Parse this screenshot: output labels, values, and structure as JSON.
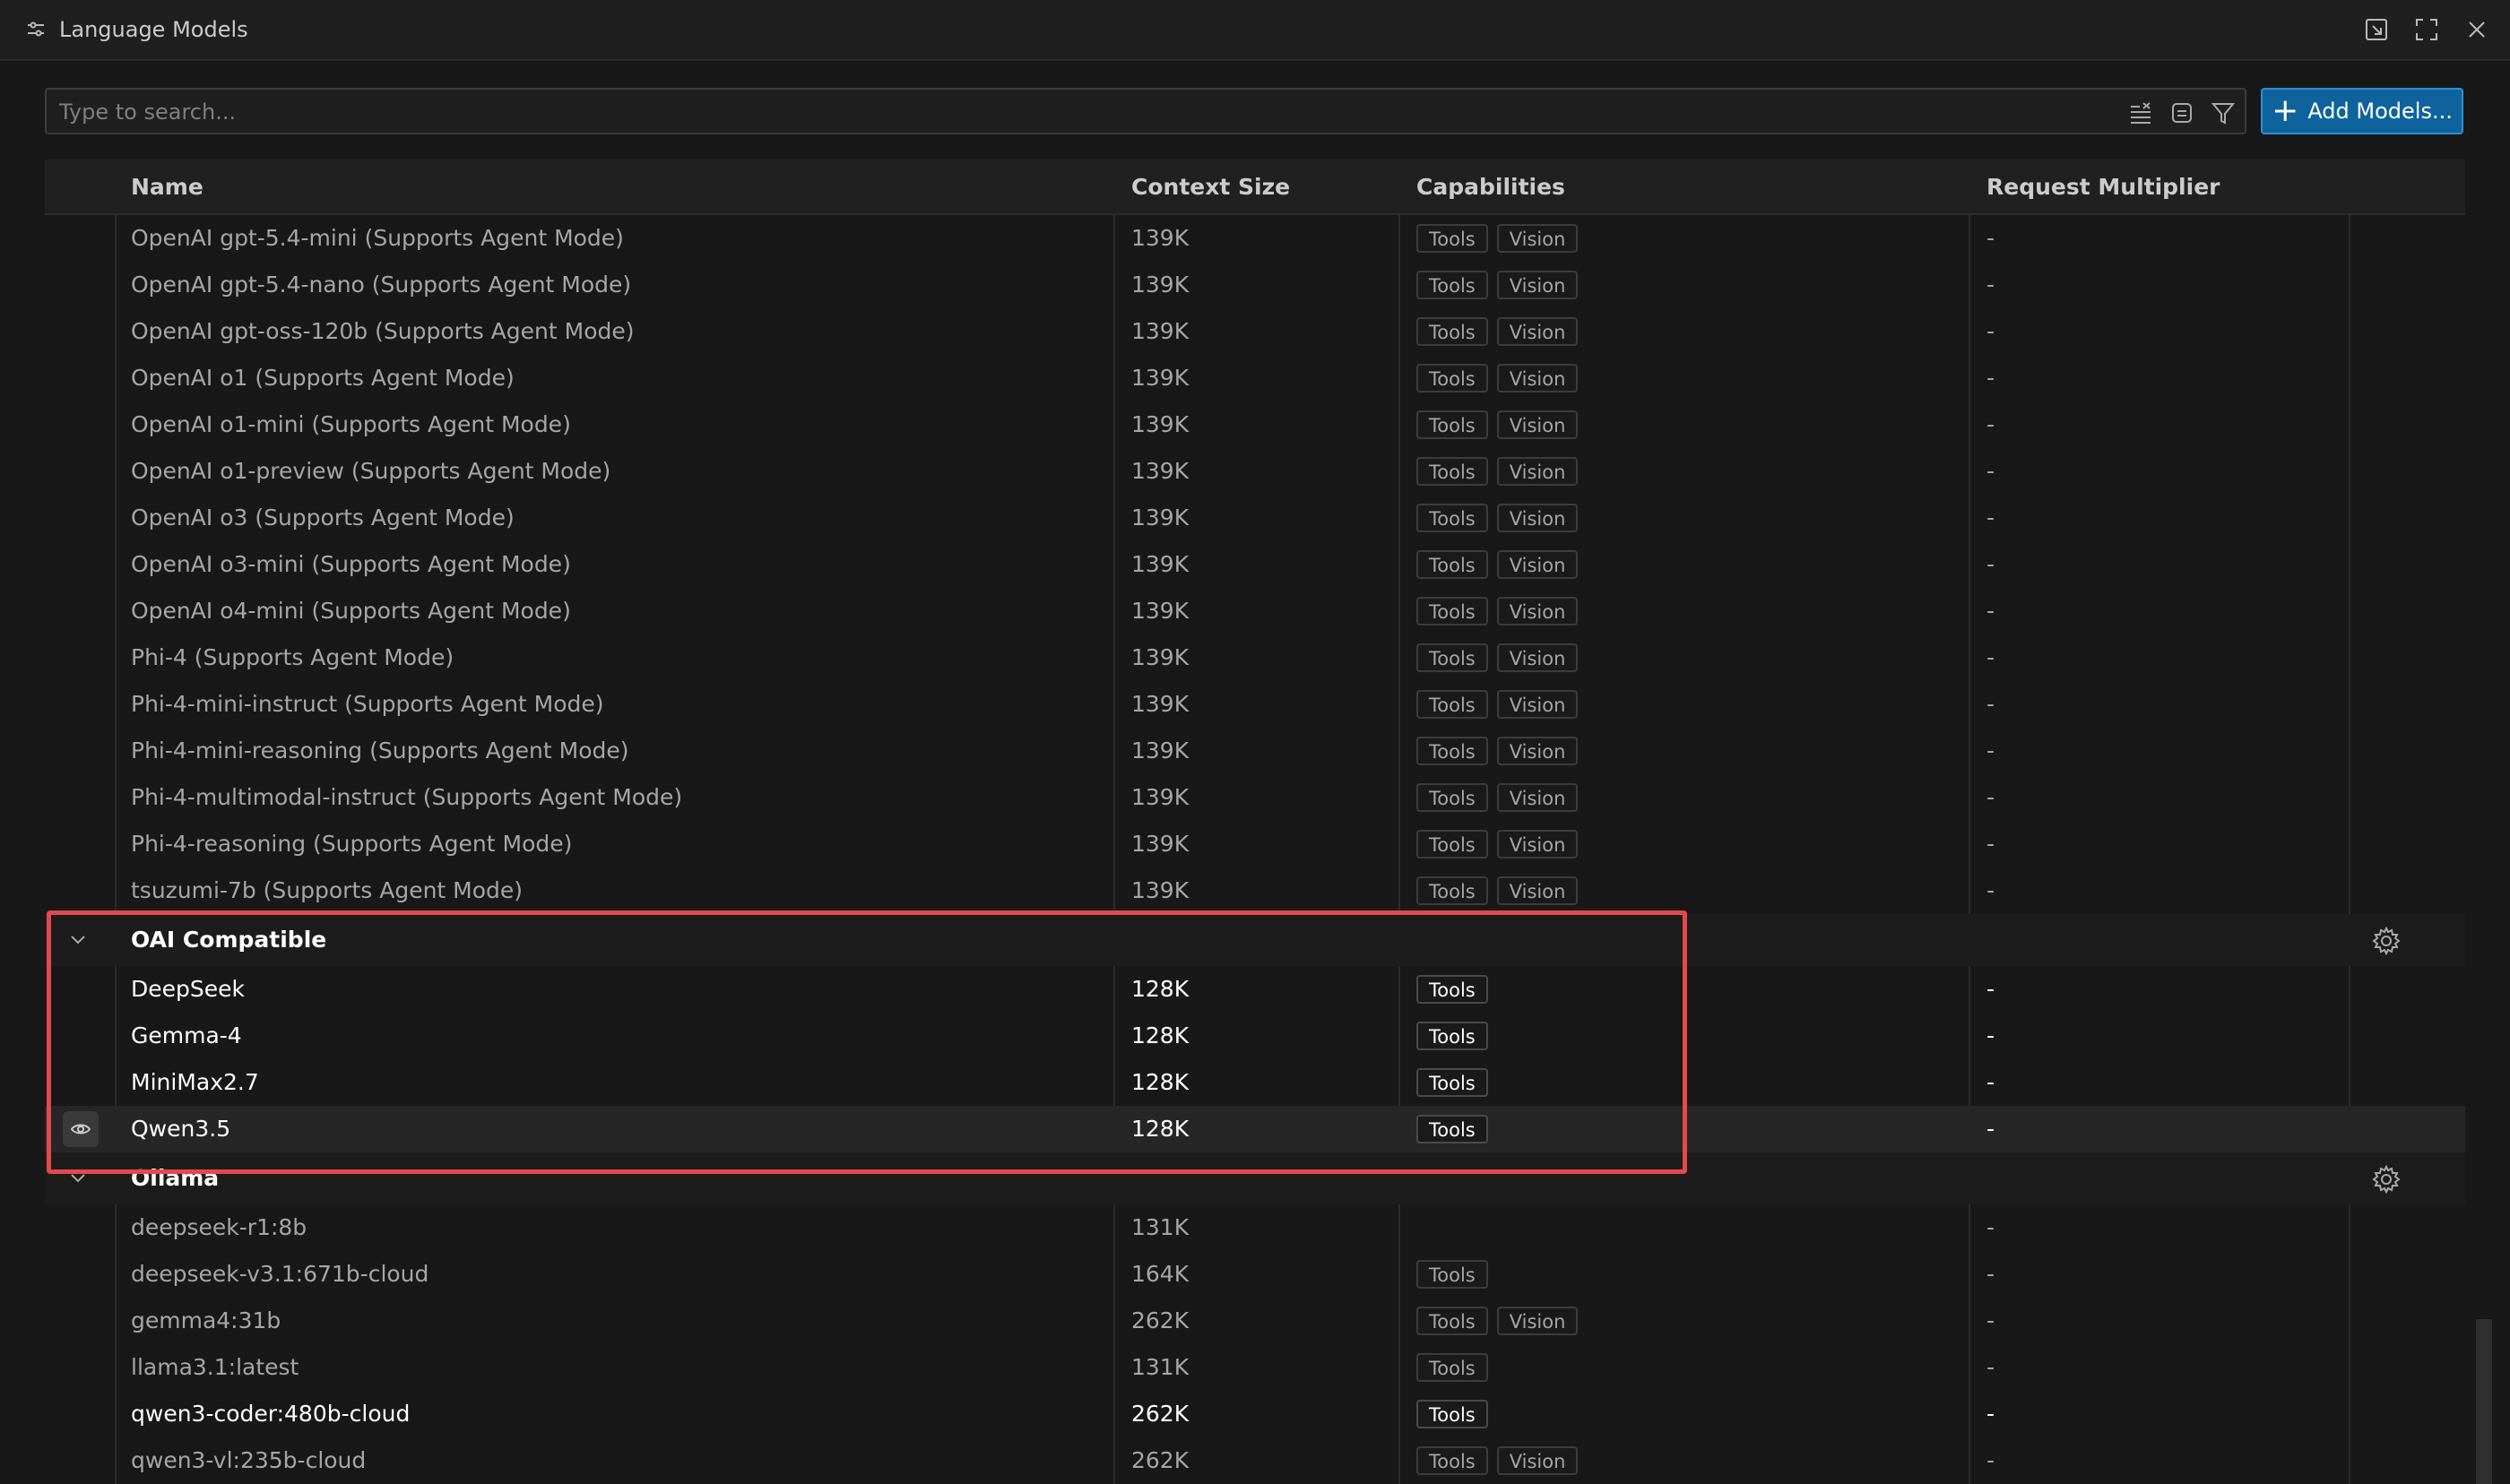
{
  "window": {
    "title": "Language Models"
  },
  "search": {
    "placeholder": "Type to search...",
    "value": ""
  },
  "toolbar": {
    "add_models_label": "Add Models..."
  },
  "columns": {
    "name": "Name",
    "context_size": "Context Size",
    "capabilities": "Capabilities",
    "request_multiplier": "Request Multiplier"
  },
  "icons": {
    "title": "settings-sliders-icon",
    "actions": [
      "open-in-editor-icon",
      "maximize-icon",
      "close-icon"
    ],
    "search": [
      "clear-filter-icon",
      "collapse-all-icon",
      "filter-icon"
    ],
    "group_toggle": "chevron-down-icon",
    "group_config": "gear-icon",
    "visibility": "eye-icon"
  },
  "colors": {
    "accent": "#0e639c",
    "highlight": "#e5484d",
    "background": "#181818"
  },
  "rows": [
    {
      "type": "model",
      "name": "OpenAI gpt-5.4-mini (Supports Agent Mode)",
      "context": "139K",
      "caps": [
        "Tools",
        "Vision"
      ],
      "multiplier": "-",
      "tone": "dim"
    },
    {
      "type": "model",
      "name": "OpenAI gpt-5.4-nano (Supports Agent Mode)",
      "context": "139K",
      "caps": [
        "Tools",
        "Vision"
      ],
      "multiplier": "-",
      "tone": "dim"
    },
    {
      "type": "model",
      "name": "OpenAI gpt-oss-120b (Supports Agent Mode)",
      "context": "139K",
      "caps": [
        "Tools",
        "Vision"
      ],
      "multiplier": "-",
      "tone": "dim"
    },
    {
      "type": "model",
      "name": "OpenAI o1 (Supports Agent Mode)",
      "context": "139K",
      "caps": [
        "Tools",
        "Vision"
      ],
      "multiplier": "-",
      "tone": "dim"
    },
    {
      "type": "model",
      "name": "OpenAI o1-mini (Supports Agent Mode)",
      "context": "139K",
      "caps": [
        "Tools",
        "Vision"
      ],
      "multiplier": "-",
      "tone": "dim"
    },
    {
      "type": "model",
      "name": "OpenAI o1-preview (Supports Agent Mode)",
      "context": "139K",
      "caps": [
        "Tools",
        "Vision"
      ],
      "multiplier": "-",
      "tone": "dim"
    },
    {
      "type": "model",
      "name": "OpenAI o3 (Supports Agent Mode)",
      "context": "139K",
      "caps": [
        "Tools",
        "Vision"
      ],
      "multiplier": "-",
      "tone": "dim"
    },
    {
      "type": "model",
      "name": "OpenAI o3-mini (Supports Agent Mode)",
      "context": "139K",
      "caps": [
        "Tools",
        "Vision"
      ],
      "multiplier": "-",
      "tone": "dim"
    },
    {
      "type": "model",
      "name": "OpenAI o4-mini (Supports Agent Mode)",
      "context": "139K",
      "caps": [
        "Tools",
        "Vision"
      ],
      "multiplier": "-",
      "tone": "dim"
    },
    {
      "type": "model",
      "name": "Phi-4 (Supports Agent Mode)",
      "context": "139K",
      "caps": [
        "Tools",
        "Vision"
      ],
      "multiplier": "-",
      "tone": "dim"
    },
    {
      "type": "model",
      "name": "Phi-4-mini-instruct (Supports Agent Mode)",
      "context": "139K",
      "caps": [
        "Tools",
        "Vision"
      ],
      "multiplier": "-",
      "tone": "dim"
    },
    {
      "type": "model",
      "name": "Phi-4-mini-reasoning (Supports Agent Mode)",
      "context": "139K",
      "caps": [
        "Tools",
        "Vision"
      ],
      "multiplier": "-",
      "tone": "dim"
    },
    {
      "type": "model",
      "name": "Phi-4-multimodal-instruct (Supports Agent Mode)",
      "context": "139K",
      "caps": [
        "Tools",
        "Vision"
      ],
      "multiplier": "-",
      "tone": "dim"
    },
    {
      "type": "model",
      "name": "Phi-4-reasoning (Supports Agent Mode)",
      "context": "139K",
      "caps": [
        "Tools",
        "Vision"
      ],
      "multiplier": "-",
      "tone": "dim"
    },
    {
      "type": "model",
      "name": "tsuzumi-7b (Supports Agent Mode)",
      "context": "139K",
      "caps": [
        "Tools",
        "Vision"
      ],
      "multiplier": "-",
      "tone": "dim"
    },
    {
      "type": "group",
      "name": "OAI Compatible"
    },
    {
      "type": "model",
      "name": "DeepSeek",
      "context": "128K",
      "caps": [
        "Tools"
      ],
      "multiplier": "-",
      "tone": "bright"
    },
    {
      "type": "model",
      "name": "Gemma-4",
      "context": "128K",
      "caps": [
        "Tools"
      ],
      "multiplier": "-",
      "tone": "bright"
    },
    {
      "type": "model",
      "name": "MiniMax2.7",
      "context": "128K",
      "caps": [
        "Tools"
      ],
      "multiplier": "-",
      "tone": "bright"
    },
    {
      "type": "model",
      "name": "Qwen3.5",
      "context": "128K",
      "caps": [
        "Tools"
      ],
      "multiplier": "-",
      "tone": "bright",
      "hovered": true
    },
    {
      "type": "group",
      "name": "Ollama"
    },
    {
      "type": "model",
      "name": "deepseek-r1:8b",
      "context": "131K",
      "caps": [],
      "multiplier": "-",
      "tone": "dim"
    },
    {
      "type": "model",
      "name": "deepseek-v3.1:671b-cloud",
      "context": "164K",
      "caps": [
        "Tools"
      ],
      "multiplier": "-",
      "tone": "dim"
    },
    {
      "type": "model",
      "name": "gemma4:31b",
      "context": "262K",
      "caps": [
        "Tools",
        "Vision"
      ],
      "multiplier": "-",
      "tone": "dim"
    },
    {
      "type": "model",
      "name": "llama3.1:latest",
      "context": "131K",
      "caps": [
        "Tools"
      ],
      "multiplier": "-",
      "tone": "dim"
    },
    {
      "type": "model",
      "name": "qwen3-coder:480b-cloud",
      "context": "262K",
      "caps": [
        "Tools"
      ],
      "multiplier": "-",
      "tone": "bright"
    },
    {
      "type": "model",
      "name": "qwen3-vl:235b-cloud",
      "context": "262K",
      "caps": [
        "Tools",
        "Vision"
      ],
      "multiplier": "-",
      "tone": "dim"
    }
  ]
}
